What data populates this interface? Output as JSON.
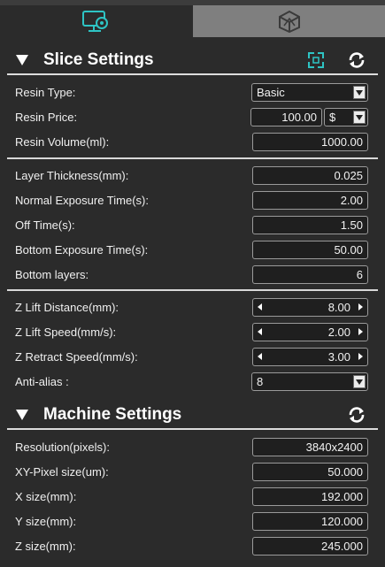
{
  "tabs": {
    "slice_icon": "monitor-gear-icon",
    "machine_icon": "printer-cube-icon"
  },
  "colors": {
    "background": "#2b2b2b",
    "accent": "#2ec4c4",
    "field_bg": "#1f1f1f",
    "inactive_tab": "#7f7f7f"
  },
  "slice": {
    "title": "Slice Settings",
    "resin_type_label": "Resin Type:",
    "resin_type_value": "Basic",
    "resin_price_label": "Resin Price:",
    "resin_price_value": "100.00",
    "currency_value": "$",
    "resin_volume_label": "Resin Volume(ml):",
    "resin_volume_value": "1000.00",
    "layer_thickness_label": "Layer Thickness(mm):",
    "layer_thickness_value": "0.025",
    "normal_exposure_label": "Normal Exposure Time(s):",
    "normal_exposure_value": "2.00",
    "off_time_label": "Off Time(s):",
    "off_time_value": "1.50",
    "bottom_exposure_label": "Bottom Exposure Time(s):",
    "bottom_exposure_value": "50.00",
    "bottom_layers_label": "Bottom layers:",
    "bottom_layers_value": "6",
    "z_lift_distance_label": "Z Lift Distance(mm):",
    "z_lift_distance_value": "8.00",
    "z_lift_speed_label": "Z Lift Speed(mm/s):",
    "z_lift_speed_value": "2.00",
    "z_retract_speed_label": "Z Retract Speed(mm/s):",
    "z_retract_speed_value": "3.00",
    "anti_alias_label": "Anti-alias :",
    "anti_alias_value": "8"
  },
  "machine": {
    "title": "Machine Settings",
    "resolution_label": "Resolution(pixels):",
    "resolution_value": "3840x2400",
    "xy_pixel_label": "XY-Pixel size(um):",
    "xy_pixel_value": "50.000",
    "x_size_label": "X size(mm):",
    "x_size_value": "192.000",
    "y_size_label": "Y size(mm):",
    "y_size_value": "120.000",
    "z_size_label": "Z size(mm):",
    "z_size_value": "245.000"
  }
}
